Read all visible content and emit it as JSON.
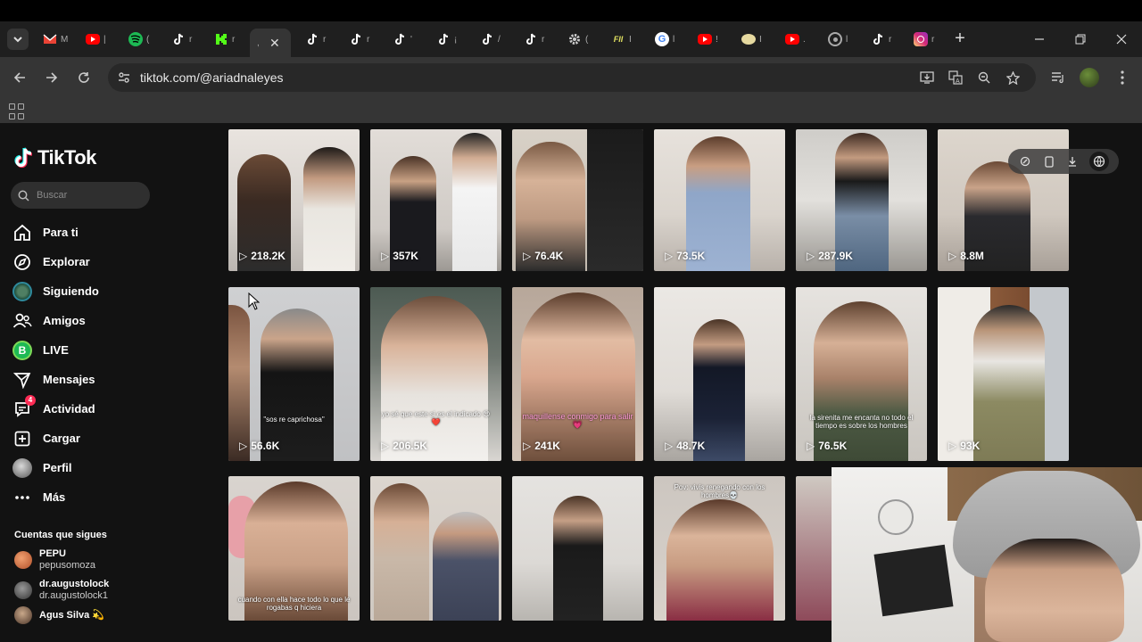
{
  "browser": {
    "tabs": [
      {
        "icon": "chevron-down-icon"
      },
      {
        "icon": "gmail-icon",
        "color": "#ea4335"
      },
      {
        "icon": "youtube-icon",
        "color": "#ff0000"
      },
      {
        "icon": "spotify-icon",
        "color": "#1db954"
      },
      {
        "icon": "tiktok-icon",
        "color": "#ffffff"
      },
      {
        "icon": "kick-icon",
        "color": "#53fc18"
      },
      {
        "icon": "tiktok-icon",
        "active": true
      },
      {
        "icon": "tiktok-icon"
      },
      {
        "icon": "tiktok-icon"
      },
      {
        "icon": "tiktok-icon"
      },
      {
        "icon": "tiktok-icon"
      },
      {
        "icon": "tiktok-icon"
      },
      {
        "icon": "tiktok-icon"
      },
      {
        "icon": "settings-icon"
      },
      {
        "icon": "fii-icon"
      },
      {
        "icon": "google-icon"
      },
      {
        "icon": "youtube-icon"
      },
      {
        "icon": "extension-icon"
      },
      {
        "icon": "youtube-icon"
      },
      {
        "icon": "chrome-icon"
      },
      {
        "icon": "tiktok-icon"
      },
      {
        "icon": "instagram-icon"
      }
    ],
    "url": "tiktok.com/@ariadnaleyes"
  },
  "tiktok": {
    "logo_text": "TikTok",
    "search_placeholder": "Buscar",
    "nav": [
      {
        "label": "Para ti",
        "icon": "home-icon"
      },
      {
        "label": "Explorar",
        "icon": "compass-icon"
      },
      {
        "label": "Siguiendo",
        "icon": "following-avatar-icon"
      },
      {
        "label": "Amigos",
        "icon": "friends-icon"
      },
      {
        "label": "LIVE",
        "icon": "live-icon"
      },
      {
        "label": "Mensajes",
        "icon": "send-icon"
      },
      {
        "label": "Actividad",
        "icon": "activity-icon",
        "badge": "4"
      },
      {
        "label": "Cargar",
        "icon": "upload-icon"
      },
      {
        "label": "Perfil",
        "icon": "profile-avatar-icon"
      },
      {
        "label": "Más",
        "icon": "more-icon"
      }
    ],
    "following_heading": "Cuentas que sigues",
    "following": [
      {
        "name": "PEPU",
        "handle": "pepusomoza"
      },
      {
        "name": "dr.augustolock",
        "handle": "dr.augustolock1"
      },
      {
        "name": "Agus Silva 💫",
        "handle": ""
      }
    ],
    "videos": [
      {
        "views": "218.2K",
        "caption": ""
      },
      {
        "views": "357K",
        "caption": ""
      },
      {
        "views": "76.4K",
        "caption": ""
      },
      {
        "views": "73.5K",
        "caption": ""
      },
      {
        "views": "287.9K",
        "caption": ""
      },
      {
        "views": "8.8M",
        "caption": ""
      },
      {
        "views": "56.6K",
        "caption": "\"sos re caprichosa\""
      },
      {
        "views": "206.5K",
        "caption": "yo sé que este si es el indicado 😍❤️"
      },
      {
        "views": "241K",
        "caption": "maquillense conmigo para salir 💗"
      },
      {
        "views": "48.7K",
        "caption": ""
      },
      {
        "views": "76.5K",
        "caption": "la sirenita me encanta no todo el tiempo es sobre los hombres"
      },
      {
        "views": "93K",
        "caption": ""
      },
      {
        "views": "",
        "caption": "cuando con ella hace todo lo que le rogabas q hiciera"
      },
      {
        "views": "",
        "caption": ""
      },
      {
        "views": "",
        "caption": ""
      },
      {
        "views": "",
        "caption": "Pov: vivis renegando con los hombres💀"
      },
      {
        "views": "",
        "caption": ""
      }
    ]
  }
}
